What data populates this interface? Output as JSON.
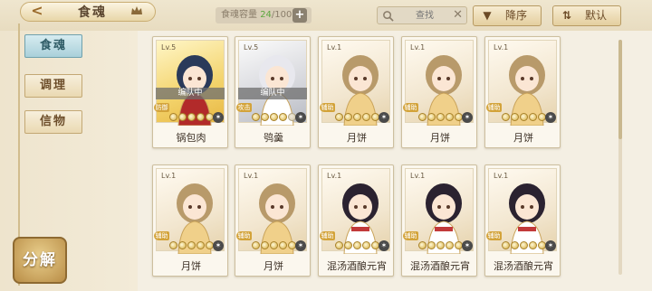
{
  "header": {
    "back_label": "<",
    "title": "食魂",
    "capacity_label": "食魂容量",
    "capacity_current": "24",
    "capacity_max": "/1000",
    "search_placeholder": "查找",
    "sort_label": "降序",
    "default_label": "默认"
  },
  "sidebar": {
    "tabs": [
      {
        "label": "食魂",
        "active": true
      },
      {
        "label": "调理",
        "active": false
      },
      {
        "label": "信物",
        "active": false
      }
    ],
    "decompose_label": "分解"
  },
  "cards": [
    {
      "level": "Lv.5",
      "name": "锅包肉",
      "status": "编队中",
      "role": "防御",
      "stars": 5,
      "theme": "gold"
    },
    {
      "level": "Lv.5",
      "name": "鸮羹",
      "status": "编队中",
      "role": "攻击",
      "stars": 4,
      "theme": "silver"
    },
    {
      "level": "Lv.1",
      "name": "月饼",
      "status": "",
      "role": "辅助",
      "stars": 5,
      "theme": "cream"
    },
    {
      "level": "Lv.1",
      "name": "月饼",
      "status": "",
      "role": "辅助",
      "stars": 5,
      "theme": "cream"
    },
    {
      "level": "Lv.1",
      "name": "月饼",
      "status": "",
      "role": "辅助",
      "stars": 5,
      "theme": "cream"
    },
    {
      "level": "Lv.1",
      "name": "月饼",
      "status": "",
      "role": "辅助",
      "stars": 5,
      "theme": "cream"
    },
    {
      "level": "Lv.1",
      "name": "月饼",
      "status": "",
      "role": "辅助",
      "stars": 5,
      "theme": "cream"
    },
    {
      "level": "Lv.1",
      "name": "混汤酒酿元宵",
      "status": "",
      "role": "辅助",
      "stars": 5,
      "theme": "cream"
    },
    {
      "level": "Lv.1",
      "name": "混汤酒酿元宵",
      "status": "",
      "role": "辅助",
      "stars": 5,
      "theme": "cream"
    },
    {
      "level": "Lv.1",
      "name": "混汤酒酿元宵",
      "status": "",
      "role": "辅助",
      "stars": 5,
      "theme": "cream"
    }
  ],
  "icons": {
    "back": "chevron-left-icon",
    "crown": "crown-icon",
    "add": "plus-icon",
    "search": "search-icon",
    "clear": "close-icon",
    "sort": "sort-down-icon",
    "default": "sort-updown-icon",
    "element": "element-icon"
  },
  "colors": {
    "accent_gold": "#d4ac3c",
    "active_tab": "#a9d0da",
    "capacity_current": "#5ea73f"
  }
}
